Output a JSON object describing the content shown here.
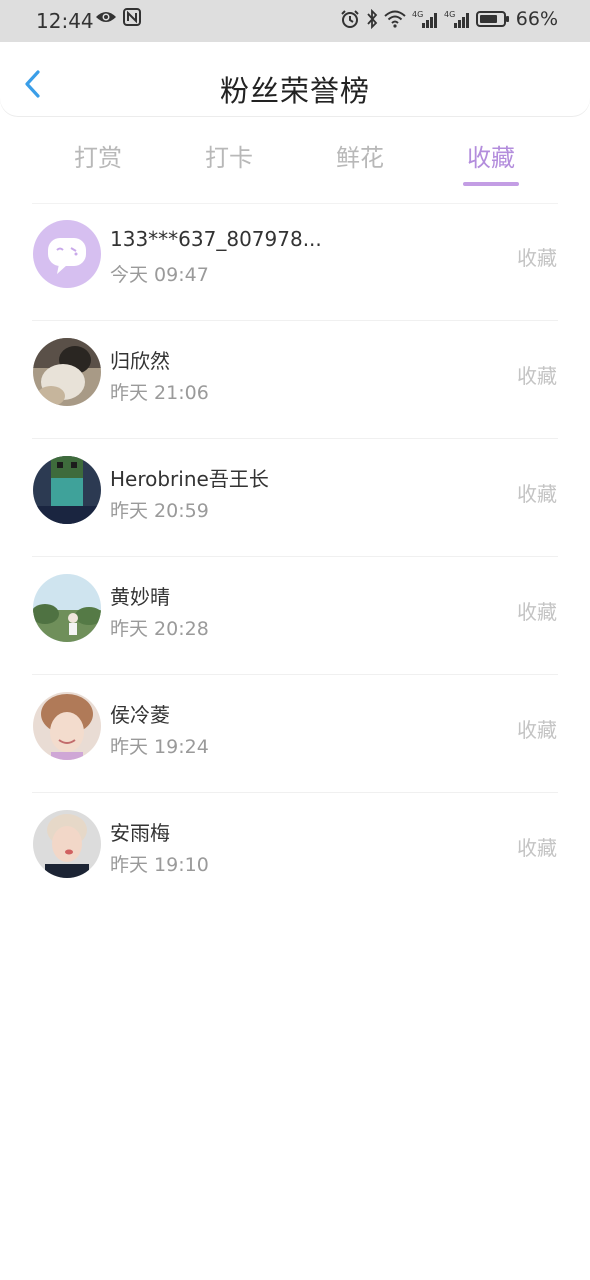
{
  "status_bar": {
    "time": "12:44",
    "battery_percent": "66%",
    "icons": [
      "eye-icon",
      "nfc-icon",
      "alarm-icon",
      "bluetooth-icon",
      "wifi-icon",
      "signal-4g-icon",
      "signal-4g-icon",
      "battery-icon"
    ]
  },
  "header": {
    "title": "粉丝荣誉榜",
    "back_icon": "chevron-left-icon"
  },
  "tabs": [
    {
      "label": "打赏",
      "active": false
    },
    {
      "label": "打卡",
      "active": false
    },
    {
      "label": "鲜花",
      "active": false
    },
    {
      "label": "收藏",
      "active": true
    }
  ],
  "list": [
    {
      "name": "133***637_807978...",
      "time": "今天 09:47",
      "action": "收藏",
      "avatar": "default-chat-avatar"
    },
    {
      "name": "归欣然",
      "time": "昨天 21:06",
      "action": "收藏",
      "avatar": "photo-avatar"
    },
    {
      "name": "Herobrine吾王长",
      "time": "昨天 20:59",
      "action": "收藏",
      "avatar": "photo-avatar"
    },
    {
      "name": "黄妙晴",
      "time": "昨天 20:28",
      "action": "收藏",
      "avatar": "photo-avatar"
    },
    {
      "name": "侯冷菱",
      "time": "昨天 19:24",
      "action": "收藏",
      "avatar": "photo-avatar"
    },
    {
      "name": "安雨梅",
      "time": "昨天 19:10",
      "action": "收藏",
      "avatar": "photo-avatar"
    }
  ],
  "colors": {
    "accent": "#b38ddc",
    "back_arrow": "#3a9ee8",
    "status_bar_bg": "#dedede"
  }
}
